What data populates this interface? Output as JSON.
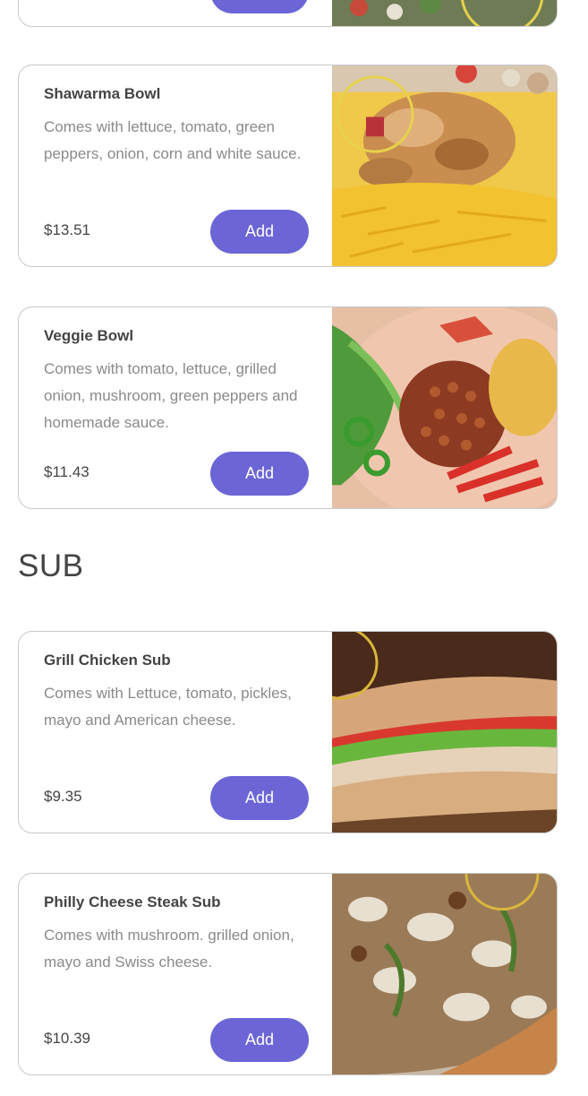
{
  "section_sub": {
    "title": "SUB"
  },
  "colors": {
    "accent": "#6b65d6",
    "text": "#444444",
    "muted": "#8a8a8a",
    "border": "#c9c9c9"
  },
  "items": [
    {
      "name": "Shawarma Bowl",
      "description": "Comes with lettuce, tomato, green peppers, onion, corn and white sauce.",
      "price": "$13.51",
      "add_label": "Add",
      "image_icon": "shawarma-bowl-photo"
    },
    {
      "name": "Veggie Bowl",
      "description": "Comes with tomato, lettuce, grilled onion, mushroom, green peppers and homemade sauce.",
      "price": "$11.43",
      "add_label": "Add",
      "image_icon": "veggie-bowl-photo"
    },
    {
      "name": "Grill Chicken Sub",
      "description": "Comes with Lettuce, tomato, pickles, mayo and American cheese.",
      "price": "$9.35",
      "add_label": "Add",
      "image_icon": "grill-chicken-sub-photo"
    },
    {
      "name": "Philly Cheese Steak Sub",
      "description": "Comes with mushroom. grilled onion, mayo and Swiss cheese.",
      "price": "$10.39",
      "add_label": "Add",
      "image_icon": "philly-cheese-steak-sub-photo"
    }
  ]
}
